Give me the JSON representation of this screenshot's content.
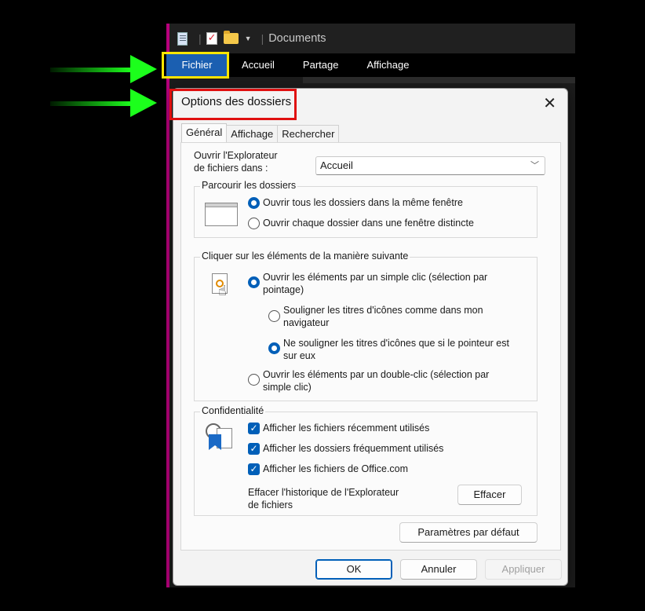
{
  "explorer": {
    "title": "Documents",
    "ribbon_tabs": [
      "Fichier",
      "Accueil",
      "Partage",
      "Affichage"
    ]
  },
  "dialog": {
    "title": "Options des dossiers",
    "tabs": [
      "Général",
      "Affichage",
      "Rechercher"
    ],
    "open_in": {
      "label_line1": "Ouvrir l'Explorateur",
      "label_line2": "de fichiers dans :",
      "selected": "Accueil"
    },
    "browse": {
      "title": "Parcourir les dossiers",
      "opt_same": "Ouvrir tous les dossiers dans la même fenêtre",
      "opt_separate": "Ouvrir chaque dossier dans une fenêtre distincte"
    },
    "click": {
      "title": "Cliquer sur les éléments de la manière suivante",
      "single_line1": "Ouvrir les éléments par un simple clic (sélection par",
      "single_line2": "pointage)",
      "underline_browser_line1": "Souligner les titres d'icônes comme dans mon",
      "underline_browser_line2": "navigateur",
      "underline_hover_line1": "Ne souligner les titres d'icônes que si le pointeur est",
      "underline_hover_line2": "sur eux",
      "double_line1": "Ouvrir les éléments par un double-clic (sélection par",
      "double_line2": "simple clic)"
    },
    "privacy": {
      "title": "Confidentialité",
      "recent_files": "Afficher les fichiers récemment utilisés",
      "frequent_folders": "Afficher les dossiers fréquemment utilisés",
      "office_files": "Afficher les fichiers de Office.com",
      "clear_label_line1": "Effacer l'historique de l'Explorateur",
      "clear_label_line2": "de fichiers",
      "clear_button": "Effacer"
    },
    "defaults_button": "Paramètres par défaut",
    "ok_button": "OK",
    "cancel_button": "Annuler",
    "apply_button": "Appliquer"
  },
  "colors": {
    "accent": "#005fb8",
    "highlight_yellow": "#ffe600",
    "highlight_red": "#e01010",
    "arrow_green": "#1cff1c"
  }
}
